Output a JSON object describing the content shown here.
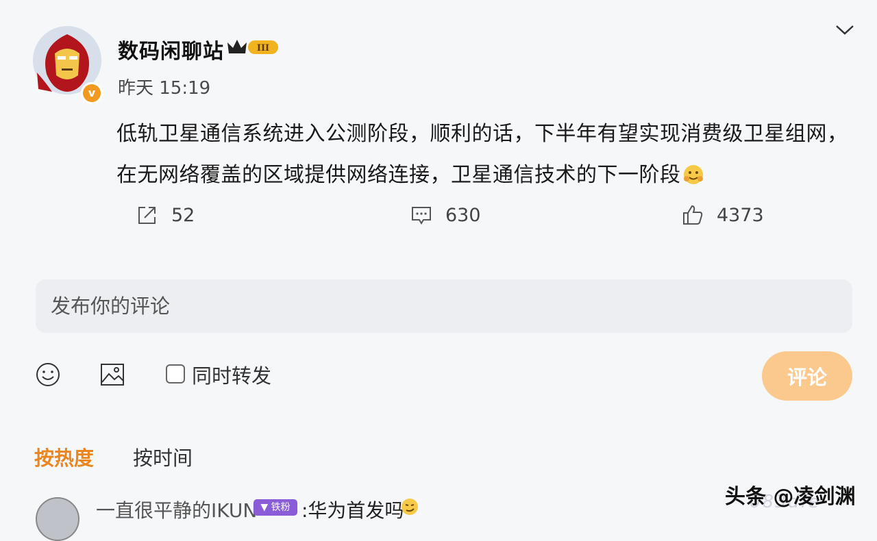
{
  "post": {
    "author": "数码闲聊站",
    "level_badge": "III",
    "verified_mark": "v",
    "time": "昨天 15:19",
    "text": "低轨卫星通信系统进入公测阶段，顺利的话，下半年有望实现消费级卫星组网，在无网络覆盖的区域提供网络连接，卫星通信技术的下一阶段",
    "avatar_icon": "iron-man-avatar",
    "emoji_icon": "hug-emoji"
  },
  "actions": {
    "repost_count": "52",
    "comment_count": "630",
    "like_count": "4373"
  },
  "composer": {
    "placeholder": "发布你的评论",
    "repost_label": "同时转发",
    "submit_label": "评论"
  },
  "sort": {
    "hot": "按热度",
    "time": "按时间"
  },
  "comment": {
    "username": "一直很平静的IKUN",
    "badge": "▼ 铁粉",
    "text": ":华为首发吗"
  },
  "watermark": {
    "main": "头条 @凌剑渊",
    "faint": "083dfe"
  },
  "colors": {
    "accent": "#e9861f",
    "submit_bg": "#fbc88e",
    "badge_purple": "#8a5cd8",
    "verified": "#f29a1f"
  }
}
